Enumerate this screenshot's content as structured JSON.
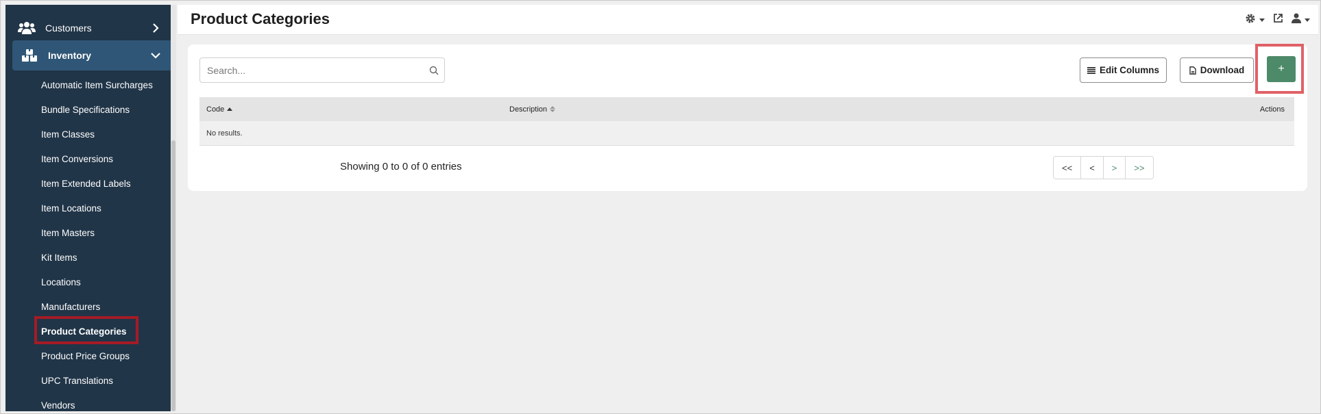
{
  "sidebar": {
    "top_items": [
      {
        "label": "Customers",
        "icon": "users-icon"
      },
      {
        "label": "Inventory",
        "icon": "boxes-icon",
        "expanded": true
      }
    ],
    "sub_items": [
      {
        "label": "Automatic Item Surcharges"
      },
      {
        "label": "Bundle Specifications"
      },
      {
        "label": "Item Classes"
      },
      {
        "label": "Item Conversions"
      },
      {
        "label": "Item Extended Labels"
      },
      {
        "label": "Item Locations"
      },
      {
        "label": "Item Masters"
      },
      {
        "label": "Kit Items"
      },
      {
        "label": "Locations"
      },
      {
        "label": "Manufacturers"
      },
      {
        "label": "Product Categories",
        "active": true
      },
      {
        "label": "Product Price Groups"
      },
      {
        "label": "UPC Translations"
      },
      {
        "label": "Vendors"
      }
    ]
  },
  "header": {
    "title": "Product Categories",
    "icons": [
      "gear-icon",
      "external-link-icon",
      "user-icon"
    ]
  },
  "toolbar": {
    "search_placeholder": "Search...",
    "search_value": "",
    "edit_columns_label": "Edit Columns",
    "download_label": "Download",
    "add_label": "+"
  },
  "table": {
    "columns": {
      "code": "Code",
      "description": "Description",
      "actions": "Actions"
    },
    "empty_text": "No results."
  },
  "pagination": {
    "showing_text": "Showing 0 to 0 of 0 entries",
    "first": "<<",
    "prev": "<",
    "next": ">",
    "last": ">>"
  },
  "colors": {
    "sidebar_bg": "#213548",
    "sidebar_active_bg": "#2f5676",
    "accent_green": "#4d8a6a",
    "highlight_red": "#a51b26",
    "highlight_pink": "#e06167"
  }
}
